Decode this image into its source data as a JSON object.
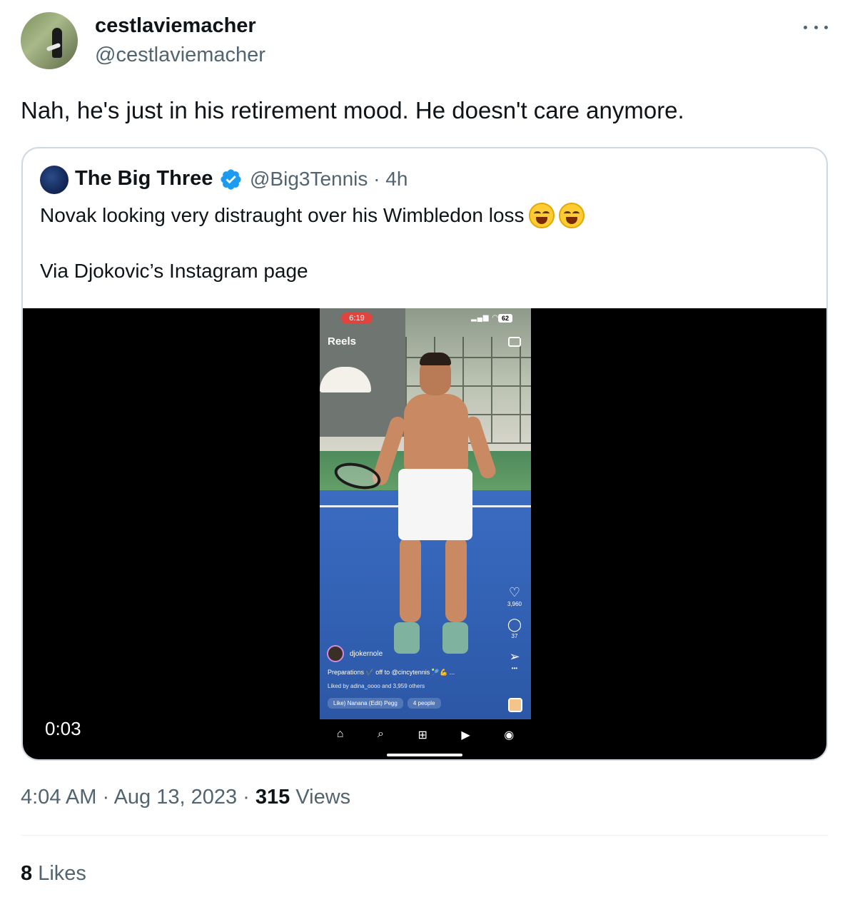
{
  "tweet": {
    "author": {
      "display_name": "cestlaviemacher",
      "handle": "@cestlaviemacher"
    },
    "text": "Nah, he's just in his retirement mood. He doesn't care anymore.",
    "timestamp": "4:04 AM · Aug 13, 2023 · ",
    "views_count": "315",
    "views_label": " Views",
    "likes_count": "8",
    "likes_label": " Likes"
  },
  "quote": {
    "display_name": "The Big Three",
    "handle_time": "@Big3Tennis · 4h",
    "line1": "Novak looking very distraught over his Wimbledon loss",
    "line1_emojis": [
      "face-with-tears-of-joy",
      "face-with-tears-of-joy"
    ],
    "line2": "Via Djokovic’s Instagram page",
    "verified_color": "#1d9bf0",
    "video": {
      "timer": "0:03",
      "instagram": {
        "status_time": "6:19",
        "battery": "62",
        "header": "Reels",
        "likes": "3,960",
        "comments": "37",
        "username": "djokernole",
        "caption": "Preparations ✔️ off to @cincytennis 🎾💪 ...",
        "liked_by": "Liked by adina_oooo and 3,959 others",
        "music": "Like) Nanana (Edit)  Pegg",
        "people": "4 people"
      }
    }
  }
}
